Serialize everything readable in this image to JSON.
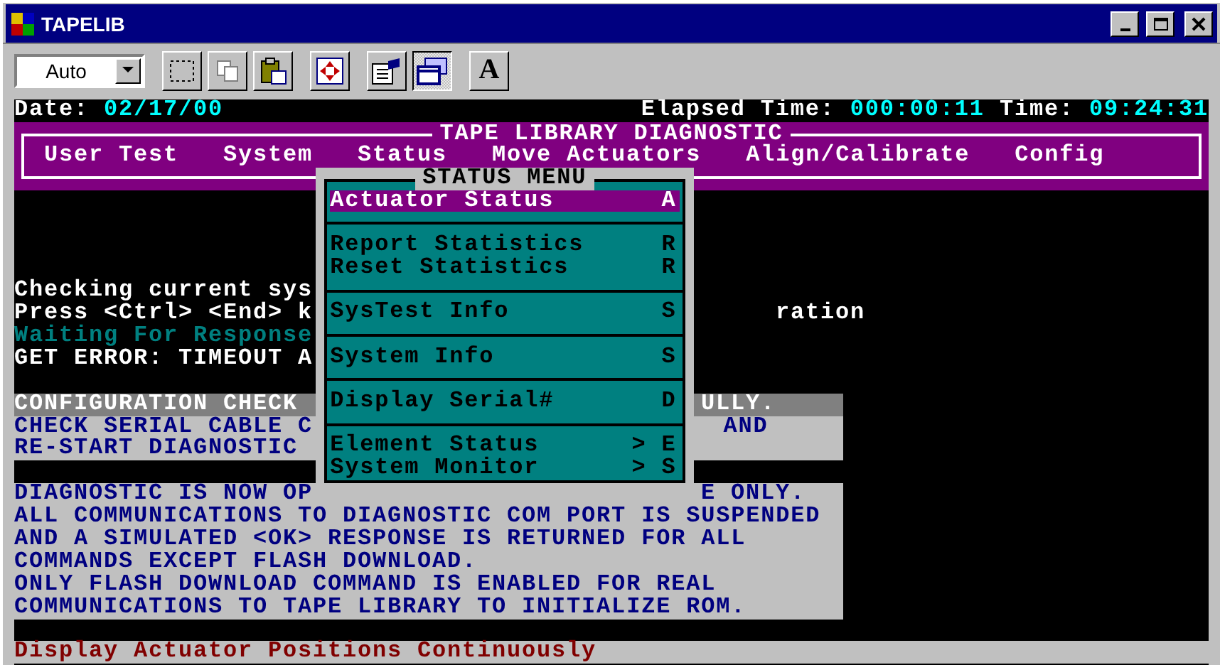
{
  "window": {
    "title": "TAPELIB"
  },
  "toolbar": {
    "font_size": "Auto",
    "tools": [
      {
        "kind": "mark",
        "pressed": false
      },
      {
        "kind": "copy",
        "pressed": false
      },
      {
        "kind": "paste",
        "pressed": false
      },
      {
        "kind": "fullscreen",
        "pressed": false
      },
      {
        "kind": "properties",
        "pressed": false
      },
      {
        "kind": "background",
        "pressed": true
      },
      {
        "kind": "font",
        "pressed": false,
        "label": "A"
      }
    ]
  },
  "header": {
    "date_label": "Date:",
    "date": "02/17/00",
    "elapsed_label": "Elapsed Time:",
    "elapsed": "000:00:11",
    "time_label": "Time:",
    "time": "09:24:31"
  },
  "panel": {
    "title": "TAPE LIBRARY DIAGNOSTIC",
    "menu": [
      "User Test",
      "System",
      "Status",
      "Move Actuators",
      "Align/Calibrate",
      "Config"
    ]
  },
  "log": [
    {
      "kind": "normal",
      "left": "Checking current sys"
    },
    {
      "kind": "normal",
      "left": "Press <Ctrl> <End> k",
      "right": "ration"
    },
    {
      "kind": "waiting",
      "left": "Waiting For Response"
    },
    {
      "kind": "normal",
      "left": "GET ERROR: TIMEOUT A"
    }
  ],
  "config_box": {
    "heading_left": "CONFIGURATION CHECK",
    "heading_right": "ULLY.",
    "lines": [
      {
        "left": "CHECK SERIAL CABLE C",
        "right": "AND"
      },
      {
        "left": "RE-START DIAGNOSTIC"
      }
    ]
  },
  "notice_box": {
    "lines": [
      {
        "left": "DIAGNOSTIC IS NOW OP",
        "right": "E ONLY."
      },
      {
        "left": "ALL COMMUNICATIONS TO DIAGNOSTIC COM PORT IS SUSPENDED"
      },
      {
        "left": "AND A SIMULATED <OK> RESPONSE IS RETURNED FOR ALL"
      },
      {
        "left": "COMMANDS EXCEPT FLASH DOWNLOAD."
      },
      {
        "left": "ONLY FLASH DOWNLOAD COMMAND IS ENABLED FOR REAL"
      },
      {
        "left": "COMMUNICATIONS TO TAPE LIBRARY TO INITIALIZE ROM."
      }
    ]
  },
  "status_menu": {
    "title": "STATUS MENU",
    "groups": [
      [
        {
          "label": "Actuator Status",
          "hotkey": "A",
          "selected": true
        }
      ],
      [
        {
          "label": "Report Statistics",
          "hotkey": "R",
          "selected": false
        },
        {
          "label": "Reset Statistics",
          "hotkey": "R",
          "selected": false
        }
      ],
      [
        {
          "label": "SysTest Info",
          "hotkey": "S",
          "selected": false
        }
      ],
      [
        {
          "label": "System Info",
          "hotkey": "S",
          "selected": false
        }
      ],
      [
        {
          "label": "Display Serial#",
          "hotkey": "D",
          "selected": false
        }
      ],
      [
        {
          "label": "Element Status",
          "hotkey": "> E",
          "selected": false
        },
        {
          "label": "System Monitor",
          "hotkey": "> S",
          "selected": false
        }
      ]
    ]
  },
  "status_line": "Display Actuator Positions Continuously"
}
